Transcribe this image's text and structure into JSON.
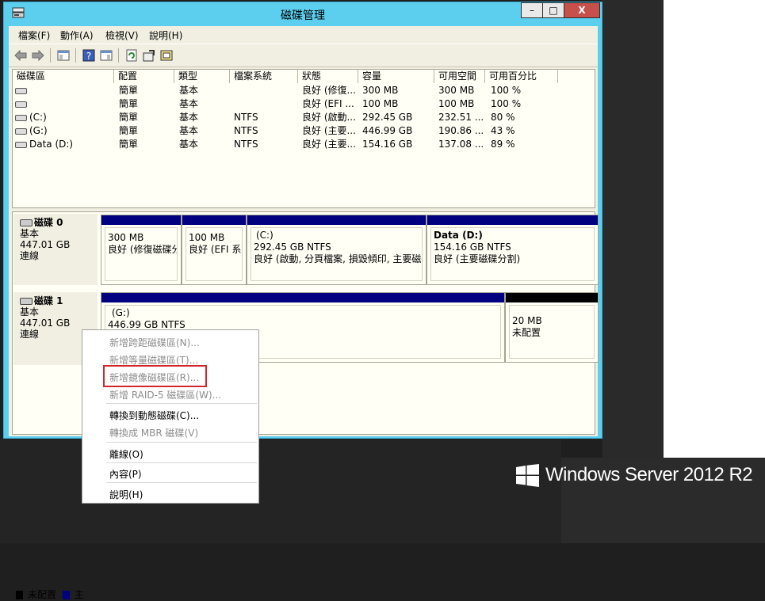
{
  "window": {
    "title": "磁碟管理",
    "buttons": {
      "minimize": "–",
      "maximize": "□",
      "close": "X"
    }
  },
  "menubar": [
    "檔案(F)",
    "動作(A)",
    "檢視(V)",
    "說明(H)"
  ],
  "toolbar": {
    "icons": [
      "back-arrow-icon",
      "forward-arrow-icon",
      "show-hide-console-tree-icon",
      "help-icon",
      "properties-pane-icon",
      "refresh-icon",
      "properties-icon",
      "rescan-disks-icon"
    ]
  },
  "volume_list": {
    "columns": [
      "磁碟區",
      "配置",
      "類型",
      "檔案系統",
      "狀態",
      "容量",
      "可用空間",
      "可用百分比"
    ],
    "rows": [
      [
        "",
        "簡單",
        "基本",
        "",
        "良好 (修復...",
        "300 MB",
        "300 MB",
        "100 %"
      ],
      [
        "",
        "簡單",
        "基本",
        "",
        "良好 (EFI ...",
        "100 MB",
        "100 MB",
        "100 %"
      ],
      [
        "(C:)",
        "簡單",
        "基本",
        "NTFS",
        "良好 (啟動...",
        "292.45 GB",
        "232.51 ...",
        "80 %"
      ],
      [
        "(G:)",
        "簡單",
        "基本",
        "NTFS",
        "良好 (主要...",
        "446.99 GB",
        "190.86 ...",
        "43 %"
      ],
      [
        "Data (D:)",
        "簡單",
        "基本",
        "NTFS",
        "良好 (主要...",
        "154.16 GB",
        "137.08 ...",
        "89 %"
      ]
    ]
  },
  "disks": [
    {
      "name": "磁碟 0",
      "type": "基本",
      "size": "447.01 GB",
      "status": "連線",
      "partitions": [
        {
          "title": "",
          "size": "300 MB",
          "status": "良好 (修復磁碟分"
        },
        {
          "title": "",
          "size": "100 MB",
          "status": "良好 (EFI 系統"
        },
        {
          "title": "(C:)",
          "size": "292.45 GB NTFS",
          "status": "良好 (啟動, 分頁檔案, 損毀傾印, 主要磁碟"
        },
        {
          "title": "Data  (D:)",
          "size": "154.16 GB NTFS",
          "status": "良好 (主要磁碟分割)"
        }
      ]
    },
    {
      "name": "磁碟 1",
      "type": "基本",
      "size": "447.01 GB",
      "status": "連線",
      "partitions": [
        {
          "title": "(G:)",
          "size": "446.99 GB NTFS",
          "status": ""
        },
        {
          "title": "",
          "size": "20 MB",
          "status": "未配置"
        }
      ]
    }
  ],
  "legend": [
    {
      "label": "未配置",
      "color": "#000000"
    },
    {
      "label": "主",
      "color": "#000080"
    }
  ],
  "context_menu": {
    "items": [
      {
        "label": "新增跨距磁碟區(N)...",
        "enabled": false
      },
      {
        "label": "新增等量磁碟區(T)...",
        "enabled": false
      },
      {
        "label": "新增鏡像磁碟區(R)...",
        "enabled": false,
        "highlighted": true
      },
      {
        "label": "新增 RAID-5 磁碟區(W)...",
        "enabled": false
      },
      {
        "label": "轉換到動態磁碟(C)...",
        "enabled": true
      },
      {
        "label": "轉換成 MBR 磁碟(V)",
        "enabled": false
      },
      {
        "label": "離線(O)",
        "enabled": true
      },
      {
        "label": "內容(P)",
        "enabled": true
      },
      {
        "label": "說明(H)",
        "enabled": true
      }
    ]
  },
  "branding": {
    "text": "Windows Server 2012 R2",
    "logo": "windows-logo"
  },
  "colors": {
    "window_frame": "#5ccfef",
    "primary_partition": "#000080",
    "unallocated": "#000000",
    "highlight_box": "#d0282c"
  }
}
